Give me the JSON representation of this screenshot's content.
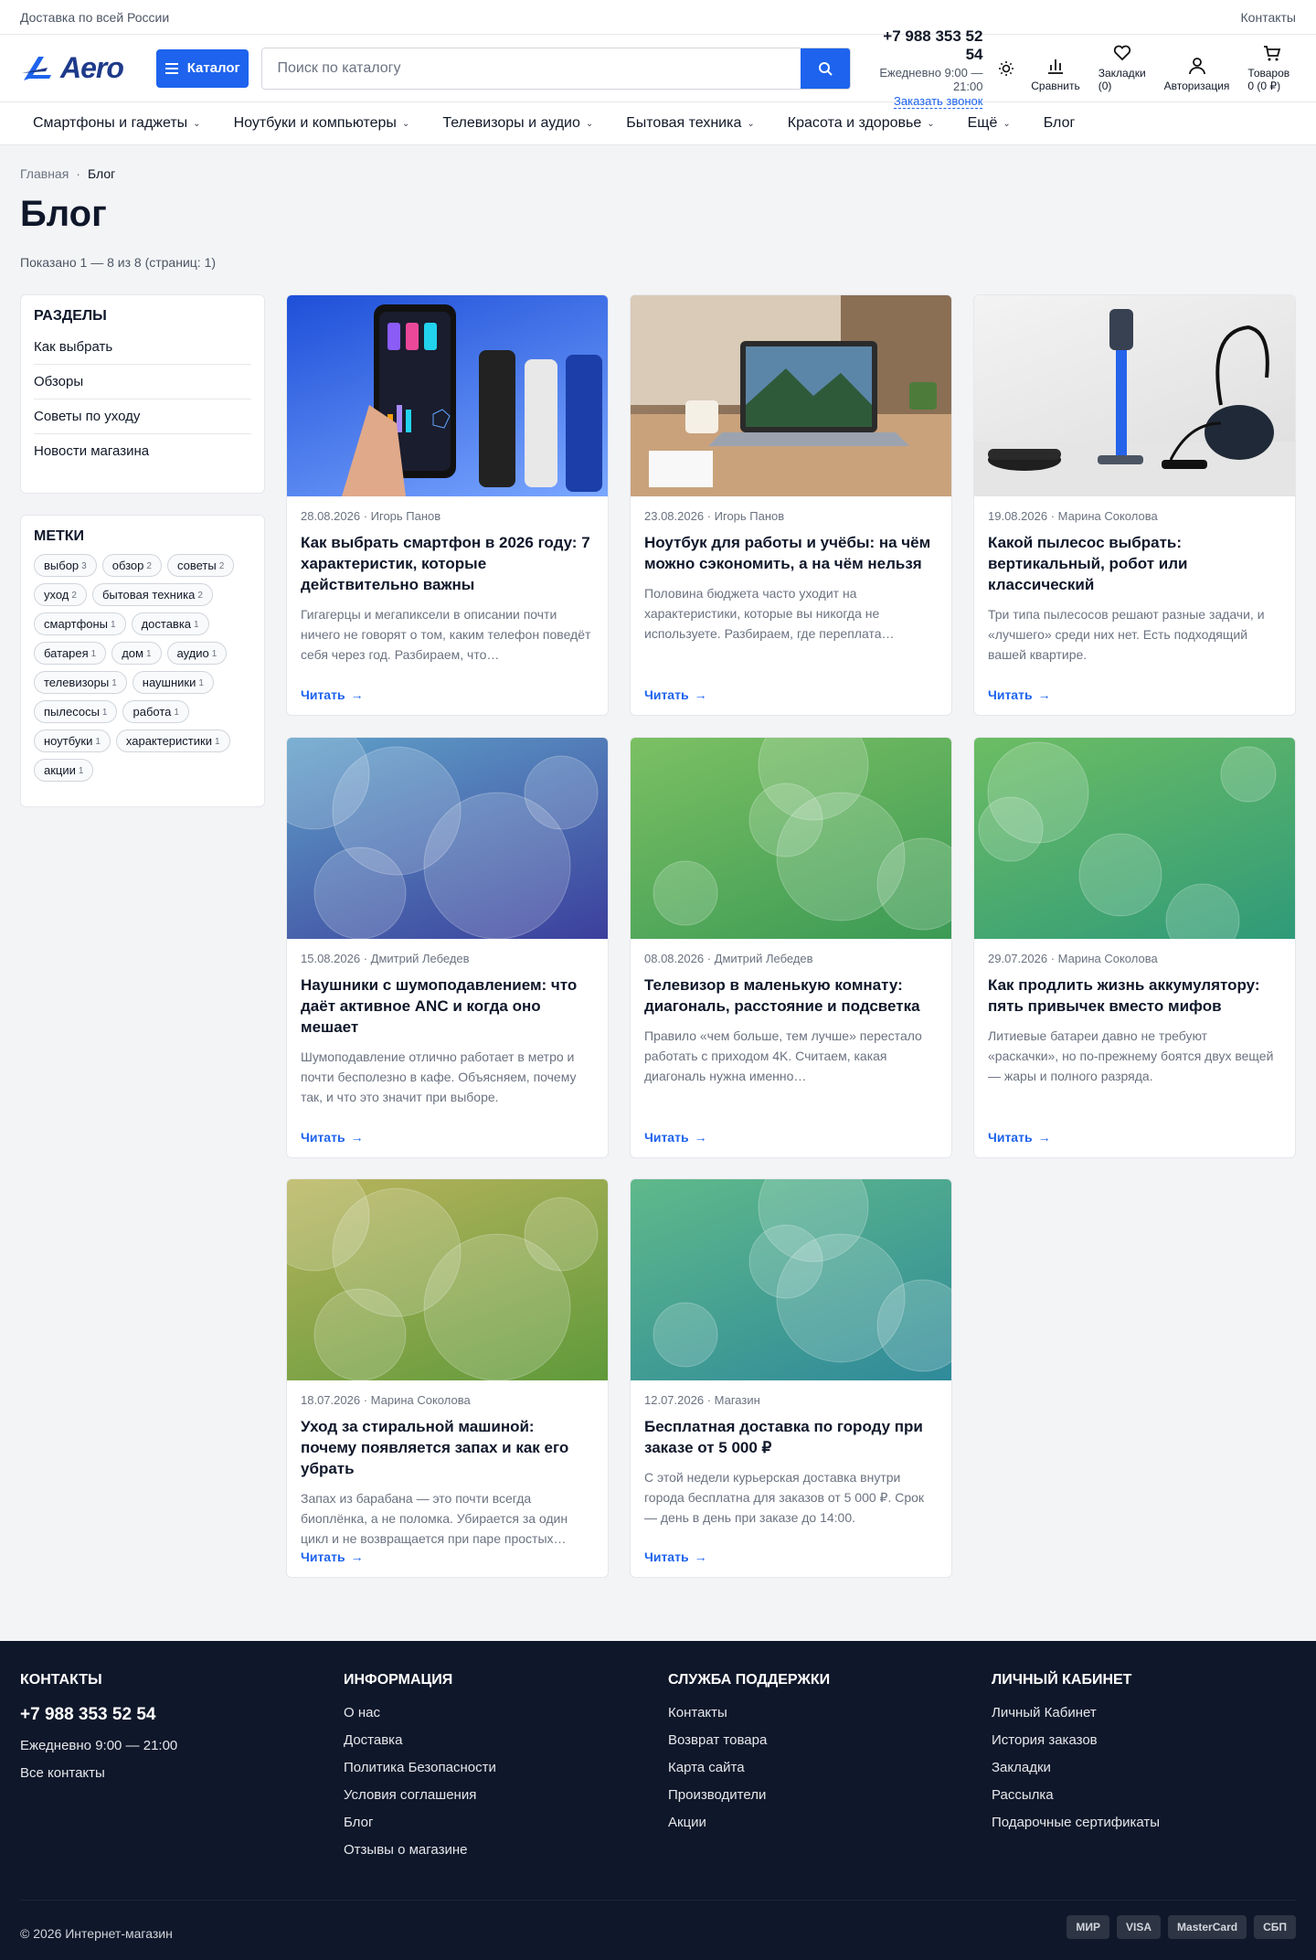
{
  "topbar": {
    "delivery": "Доставка по всей России",
    "contacts": "Контакты"
  },
  "header": {
    "logo_text": "Aero",
    "catalog_label": "Каталог",
    "search_placeholder": "Поиск по каталогу",
    "phone": "+7 988 353 52 54",
    "hours": "Ежедневно 9:00 — 21:00",
    "callback": "Заказать звонок",
    "icons": [
      {
        "label": "Сравнить",
        "icon": "compare-icon"
      },
      {
        "label": "Закладки (0)",
        "icon": "heart-icon"
      },
      {
        "label": "Авторизация",
        "icon": "user-icon"
      },
      {
        "label": "Товаров 0 (0 ₽)",
        "icon": "cart-icon"
      }
    ]
  },
  "nav": [
    "Смартфоны и гаджеты",
    "Ноутбуки и компьютеры",
    "Телевизоры и аудио",
    "Бытовая техника",
    "Красота и здоровье",
    "Ещё",
    "Блог"
  ],
  "breadcrumb": [
    "Главная",
    "Блог"
  ],
  "page": {
    "title": "Блог",
    "shown": "Показано 1 — 8 из 8 (страниц: 1)"
  },
  "sections": {
    "heading": "РАЗДЕЛЫ",
    "items": [
      "Как выбрать",
      "Обзоры",
      "Советы по уходу",
      "Новости магазина"
    ]
  },
  "tags": {
    "heading": "МЕТКИ",
    "items": [
      {
        "name": "выбор",
        "count": "3"
      },
      {
        "name": "обзор",
        "count": "2"
      },
      {
        "name": "советы",
        "count": "2"
      },
      {
        "name": "уход",
        "count": "2"
      },
      {
        "name": "бытовая техника",
        "count": "2"
      },
      {
        "name": "смартфоны",
        "count": "1"
      },
      {
        "name": "доставка",
        "count": "1"
      },
      {
        "name": "батарея",
        "count": "1"
      },
      {
        "name": "дом",
        "count": "1"
      },
      {
        "name": "аудио",
        "count": "1"
      },
      {
        "name": "телевизоры",
        "count": "1"
      },
      {
        "name": "наушники",
        "count": "1"
      },
      {
        "name": "пылесосы",
        "count": "1"
      },
      {
        "name": "работа",
        "count": "1"
      },
      {
        "name": "ноутбуки",
        "count": "1"
      },
      {
        "name": "характеристики",
        "count": "1"
      },
      {
        "name": "акции",
        "count": "1"
      }
    ]
  },
  "posts": [
    {
      "date": "28.08.2026",
      "author": "Игорь Панов",
      "title": "Как выбрать смартфон в 2026 году: 7 характеристик, которые действительно важны",
      "excerpt": "Гигагерцы и мегапиксели в описании почти ничего не говорят о том, каким телефон поведёт себя через год. Разбираем, что…",
      "read": "Читать",
      "image": "smartphone-photo",
      "colors": [
        "#1e4fd8",
        "#7aa7ff"
      ]
    },
    {
      "date": "23.08.2026",
      "author": "Игорь Панов",
      "title": "Ноутбук для работы и учёбы: на чём можно сэкономить, а на чём нельзя",
      "excerpt": "Половина бюджета часто уходит на характеристики, которые вы никогда не используете. Разбираем, где переплата…",
      "read": "Читать",
      "image": "laptop-photo",
      "colors": [
        "#b89a7a",
        "#5b4636"
      ]
    },
    {
      "date": "19.08.2026",
      "author": "Марина Соколова",
      "title": "Какой пылесос выбрать: вертикальный, робот или классический",
      "excerpt": "Три типа пылесосов решают разные задачи, и «лучшего» среди них нет. Есть подходящий вашей квартире.",
      "read": "Читать",
      "image": "vacuum-photo",
      "colors": [
        "#f3f3f3",
        "#dcdcdc"
      ]
    },
    {
      "date": "15.08.2026",
      "author": "Дмитрий Лебедев",
      "title": "Наушники с шумоподавлением: что даёт активное ANC и когда оно мешает",
      "excerpt": "Шумоподавление отлично работает в метро и почти бесполезно в кафе. Объясняем, почему так, и что это значит при выборе.",
      "read": "Читать",
      "image": "gradient-bokeh",
      "colors": [
        "#5fa0c8",
        "#3b3f9c"
      ]
    },
    {
      "date": "08.08.2026",
      "author": "Дмитрий Лебедев",
      "title": "Телевизор в маленькую комнату: диагональ, расстояние и подсветка",
      "excerpt": "Правило «чем больше, тем лучше» перестало работать с приходом 4K. Считаем, какая диагональ нужна именно…",
      "read": "Читать",
      "image": "gradient-bokeh",
      "colors": [
        "#7cc063",
        "#3b9a55"
      ]
    },
    {
      "date": "29.07.2026",
      "author": "Марина Соколова",
      "title": "Как продлить жизнь аккумулятору: пять привычек вместо мифов",
      "excerpt": "Литиевые батареи давно не требуют «раскачки», но по-прежнему боятся двух вещей — жары и полного разряда.",
      "read": "Читать",
      "image": "gradient-bokeh",
      "colors": [
        "#6cbd63",
        "#2f9a79"
      ]
    },
    {
      "date": "18.07.2026",
      "author": "Марина Соколова",
      "title": "Уход за стиральной машиной: почему появляется запах и как его убрать",
      "excerpt": "Запах из барабана — это почти всегда биоплёнка, а не поломка. Убирается за один цикл и не возвращается при паре простых…",
      "read": "Читать",
      "image": "gradient-bokeh",
      "colors": [
        "#b8b35c",
        "#5f9a3a"
      ]
    },
    {
      "date": "12.07.2026",
      "author": "Магазин",
      "title": "Бесплатная доставка по городу при заказе от 5 000 ₽",
      "excerpt": "С этой недели курьерская доставка внутри города бесплатна для заказов от 5 000 ₽. Срок — день в день при заказе до 14:00.",
      "read": "Читать",
      "image": "gradient-bokeh",
      "colors": [
        "#5fb98a",
        "#2f8a9a"
      ]
    }
  ],
  "footer": {
    "columns": [
      {
        "heading": "КОНТАКТЫ",
        "phone": "+7 988 353 52 54",
        "links": [
          "Ежедневно 9:00 — 21:00",
          "Все контакты"
        ]
      },
      {
        "heading": "ИНФОРМАЦИЯ",
        "links": [
          "О нас",
          "Доставка",
          "Политика Безопасности",
          "Условия соглашения",
          "Блог",
          "Отзывы о магазине"
        ]
      },
      {
        "heading": "СЛУЖБА ПОДДЕРЖКИ",
        "links": [
          "Контакты",
          "Возврат товара",
          "Карта сайта",
          "Производители",
          "Акции"
        ]
      },
      {
        "heading": "ЛИЧНЫЙ КАБИНЕТ",
        "links": [
          "Личный Кабинет",
          "История заказов",
          "Закладки",
          "Рассылка",
          "Подарочные сертификаты"
        ]
      }
    ],
    "copyright": "© 2026 Интернет-магазин",
    "payments": [
      "МИР",
      "VISA",
      "MasterCard",
      "СБП"
    ]
  }
}
